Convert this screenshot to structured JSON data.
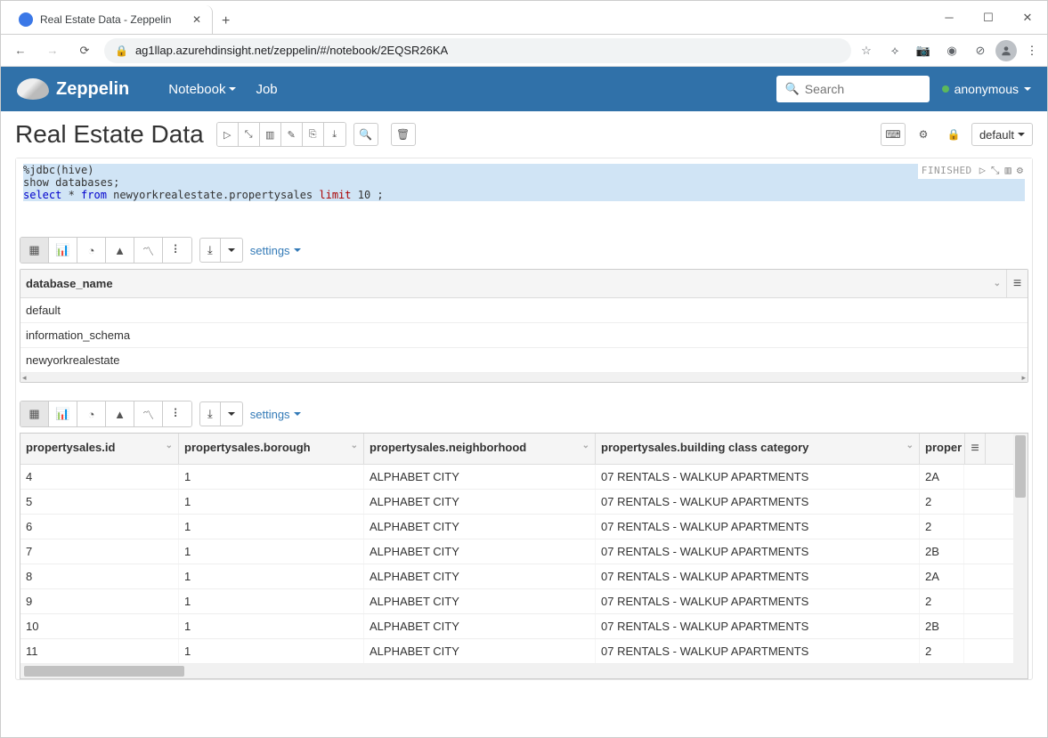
{
  "browser": {
    "tab_title": "Real Estate Data - Zeppelin",
    "url": "ag1llap.azurehdinsight.net/zeppelin/#/notebook/2EQSR26KA"
  },
  "zep_nav": {
    "brand": "Zeppelin",
    "menu": {
      "notebook": "Notebook",
      "job": "Job"
    },
    "search_placeholder": "Search",
    "user": "anonymous"
  },
  "notebook": {
    "title": "Real Estate Data",
    "mode": "default"
  },
  "paragraph": {
    "status": "FINISHED",
    "code": {
      "line1": "%jdbc(hive)",
      "line2": "show databases;",
      "line3_a": "select",
      "line3_b": " * ",
      "line3_c": "from",
      "line3_d": " newyorkrealestate.propertysales ",
      "line3_e": "limit",
      "line3_f": " 10 ;"
    },
    "settings_label": "settings"
  },
  "table1": {
    "header": "database_name",
    "rows": [
      "default",
      "information_schema",
      "newyorkrealestate"
    ]
  },
  "table2": {
    "headers": {
      "id": "propertysales.id",
      "borough": "propertysales.borough",
      "neighborhood": "propertysales.neighborhood",
      "building_class": "propertysales.building class category",
      "extra": "proper"
    },
    "rows": [
      {
        "id": "4",
        "borough": "1",
        "neighborhood": "ALPHABET CITY",
        "building_class": "07 RENTALS - WALKUP APARTMENTS",
        "extra": "2A"
      },
      {
        "id": "5",
        "borough": "1",
        "neighborhood": "ALPHABET CITY",
        "building_class": "07 RENTALS - WALKUP APARTMENTS",
        "extra": "2"
      },
      {
        "id": "6",
        "borough": "1",
        "neighborhood": "ALPHABET CITY",
        "building_class": "07 RENTALS - WALKUP APARTMENTS",
        "extra": "2"
      },
      {
        "id": "7",
        "borough": "1",
        "neighborhood": "ALPHABET CITY",
        "building_class": "07 RENTALS - WALKUP APARTMENTS",
        "extra": "2B"
      },
      {
        "id": "8",
        "borough": "1",
        "neighborhood": "ALPHABET CITY",
        "building_class": "07 RENTALS - WALKUP APARTMENTS",
        "extra": "2A"
      },
      {
        "id": "9",
        "borough": "1",
        "neighborhood": "ALPHABET CITY",
        "building_class": "07 RENTALS - WALKUP APARTMENTS",
        "extra": "2"
      },
      {
        "id": "10",
        "borough": "1",
        "neighborhood": "ALPHABET CITY",
        "building_class": "07 RENTALS - WALKUP APARTMENTS",
        "extra": "2B"
      },
      {
        "id": "11",
        "borough": "1",
        "neighborhood": "ALPHABET CITY",
        "building_class": "07 RENTALS - WALKUP APARTMENTS",
        "extra": "2"
      }
    ]
  }
}
